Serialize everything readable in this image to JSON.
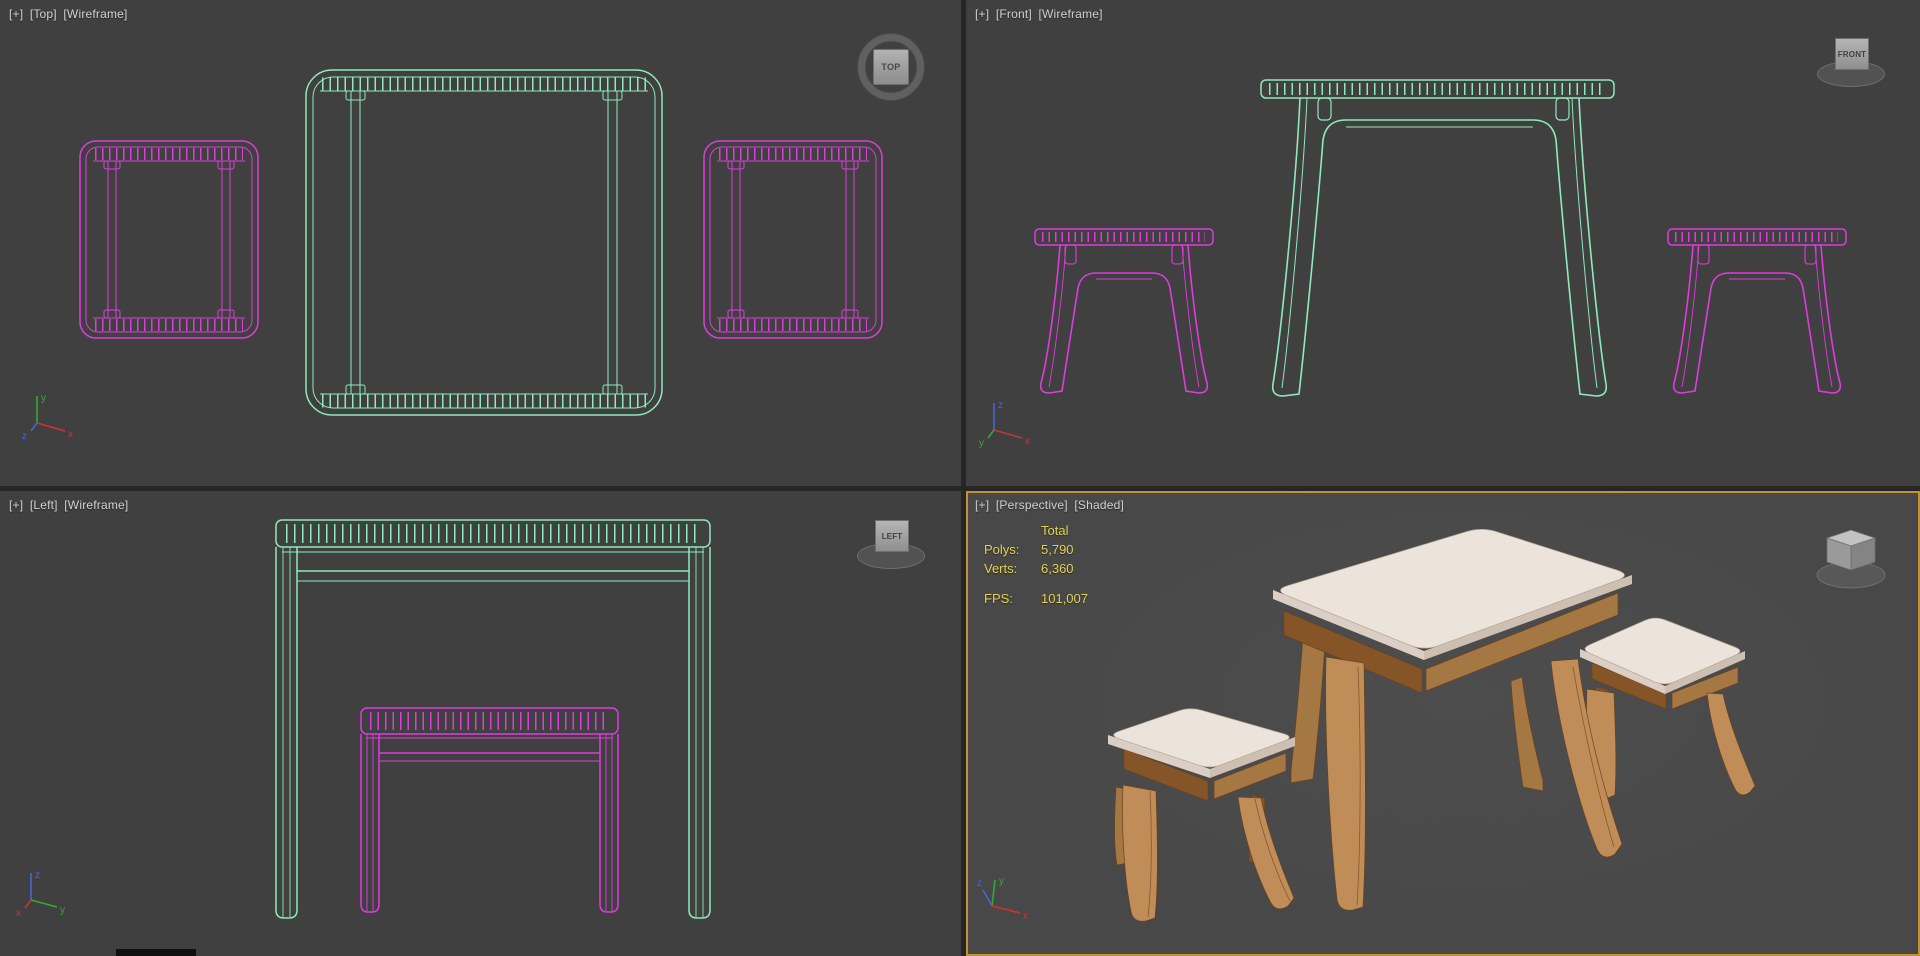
{
  "viewports": {
    "top": {
      "menu_plus": "[+]",
      "menu_view": "[Top]",
      "menu_shading": "[Wireframe]",
      "viewcube_label": "TOP"
    },
    "front": {
      "menu_plus": "[+]",
      "menu_view": "[Front]",
      "menu_shading": "[Wireframe]",
      "viewcube_label": "FRONT"
    },
    "left": {
      "menu_plus": "[+]",
      "menu_view": "[Left]",
      "menu_shading": "[Wireframe]",
      "viewcube_label": "LEFT"
    },
    "perspective": {
      "menu_plus": "[+]",
      "menu_view": "[Perspective]",
      "menu_shading": "[Shaded]",
      "stats": {
        "total_label": "Total",
        "polys_label": "Polys:",
        "polys_value": "5,790",
        "verts_label": "Verts:",
        "verts_value": "6,360",
        "fps_label": "FPS:",
        "fps_value": "101,007"
      }
    }
  },
  "axis": {
    "x": "x",
    "y": "y",
    "z": "z"
  },
  "colors": {
    "viewport_bg": "#404040",
    "viewport_bg_persp": "#484848",
    "divider": "#262626",
    "label_text": "#d2d2d2",
    "mint": "#8debbb",
    "magenta": "#df3bdf",
    "stats_text": "#e3d34f",
    "active_border": "#c09232",
    "wood_light": "#c08d58",
    "wood_mid": "#a57743",
    "wood_dark": "#855528",
    "wood_edge": "#6a431f",
    "cream": "#ece3da",
    "cream_shade": "#dbcfc5",
    "cream_dark": "#cdbfb2",
    "cream_edge": "#b5a795",
    "axis_x": "#cc3333",
    "axis_y": "#33aa33",
    "axis_z": "#4466dd"
  }
}
